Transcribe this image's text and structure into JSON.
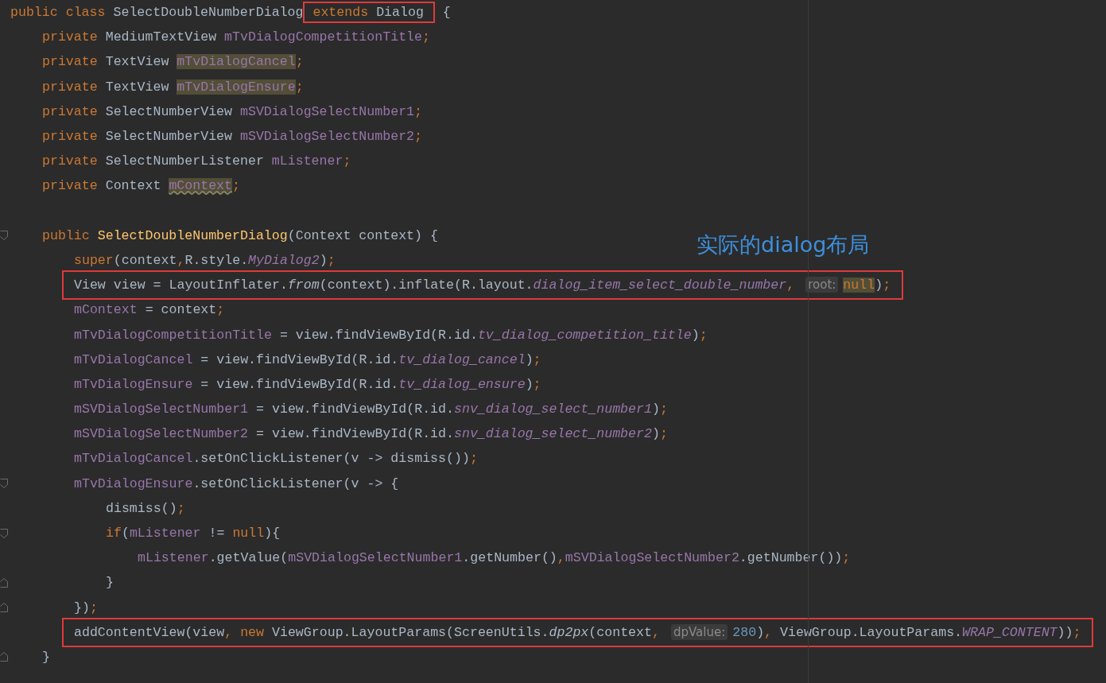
{
  "annotation": {
    "text": "实际的dialog布局"
  },
  "lines": [
    {
      "tokens": [
        {
          "t": "public class",
          "kind": "kw"
        },
        {
          "t": "SelectDoubleNumberDialog",
          "kind": "plain"
        },
        {
          "boxed": true,
          "tokens": [
            {
              "t": "extends",
              "kind": "kw"
            },
            {
              "t": "Dialog",
              "kind": "plain"
            }
          ]
        },
        {
          "t": "{",
          "kind": "plain"
        }
      ],
      "children": [
        {
          "tokens": [
            {
              "t": "private",
              "kind": "kw"
            },
            {
              "t": "MediumTextView",
              "kind": "plain"
            },
            {
              "t": "mTvDialogCompetitionTitle",
              "kind": "field"
            },
            {
              "t": ";",
              "kind": "kw"
            }
          ]
        },
        {
          "tokens": [
            {
              "t": "private",
              "kind": "kw"
            },
            {
              "t": "TextView",
              "kind": "plain"
            },
            {
              "t": "mTvDialogCancel",
              "kind": "field",
              "highlighted": true
            },
            {
              "t": ";",
              "kind": "kw"
            }
          ]
        },
        {
          "tokens": [
            {
              "t": "private",
              "kind": "kw"
            },
            {
              "t": "TextView",
              "kind": "plain"
            },
            {
              "t": "mTvDialogEnsure",
              "kind": "field",
              "highlighted": true
            },
            {
              "t": ";",
              "kind": "kw"
            }
          ]
        },
        {
          "tokens": [
            {
              "t": "private",
              "kind": "kw"
            },
            {
              "t": "SelectNumberView",
              "kind": "plain"
            },
            {
              "t": "mSVDialogSelectNumber1",
              "kind": "field"
            },
            {
              "t": ";",
              "kind": "kw"
            }
          ]
        },
        {
          "tokens": [
            {
              "t": "private",
              "kind": "kw"
            },
            {
              "t": "SelectNumberView",
              "kind": "plain"
            },
            {
              "t": "mSVDialogSelectNumber2",
              "kind": "field"
            },
            {
              "t": ";",
              "kind": "kw"
            }
          ]
        },
        {
          "tokens": [
            {
              "t": "private",
              "kind": "kw"
            },
            {
              "t": "SelectNumberListener",
              "kind": "plain"
            },
            {
              "t": "mListener",
              "kind": "field"
            },
            {
              "t": ";",
              "kind": "kw"
            }
          ]
        },
        {
          "tokens": [
            {
              "t": "private",
              "kind": "kw"
            },
            {
              "t": "Context",
              "kind": "plain"
            },
            {
              "t": "mContext",
              "kind": "field",
              "highlighted": true,
              "warning": true
            },
            {
              "t": ";",
              "kind": "kw"
            }
          ]
        },
        {
          "blank_line_before": true,
          "fold_start": true,
          "tokens": [
            {
              "t": "public",
              "kind": "kw"
            },
            {
              "t": "SelectDoubleNumberDialog",
              "kind": "decl"
            },
            {
              "t": "(Context context) {",
              "kind": "plain"
            }
          ],
          "children": [
            {
              "tokens": [
                {
                  "t": "super",
                  "kind": "kw"
                },
                {
                  "t": "(context",
                  "kind": "plain"
                },
                {
                  "t": ",",
                  "kind": "kw"
                },
                {
                  "t": "R.style.",
                  "kind": "plain"
                },
                {
                  "t": "MyDialog2",
                  "kind": "static"
                },
                {
                  "t": ")",
                  "kind": "plain"
                },
                {
                  "t": ";",
                  "kind": "kw"
                }
              ]
            },
            {
              "boxed": true,
              "tokens": [
                {
                  "t": "View view = LayoutInflater.",
                  "kind": "plain"
                },
                {
                  "t": "from",
                  "kind": "italic"
                },
                {
                  "t": "(context).inflate(R.layout.",
                  "kind": "plain"
                },
                {
                  "t": "dialog_item_select_double_number",
                  "kind": "static"
                },
                {
                  "t": ",",
                  "kind": "kw"
                },
                {
                  "t": "root:",
                  "kind": "hint"
                },
                {
                  "t": "null",
                  "kind": "kw",
                  "highlighted": true
                },
                {
                  "t": ")",
                  "kind": "plain"
                },
                {
                  "t": ";",
                  "kind": "kw"
                }
              ]
            },
            {
              "tokens": [
                {
                  "t": "mContext",
                  "kind": "field"
                },
                {
                  "t": "= context",
                  "kind": "plain"
                },
                {
                  "t": ";",
                  "kind": "kw"
                }
              ]
            },
            {
              "tokens": [
                {
                  "t": "mTvDialogCompetitionTitle",
                  "kind": "field"
                },
                {
                  "t": "= view.findViewById(R.id.",
                  "kind": "plain"
                },
                {
                  "t": "tv_dialog_competition_title",
                  "kind": "static"
                },
                {
                  "t": ")",
                  "kind": "plain"
                },
                {
                  "t": ";",
                  "kind": "kw"
                }
              ]
            },
            {
              "tokens": [
                {
                  "t": "mTvDialogCancel",
                  "kind": "field"
                },
                {
                  "t": "= view.findViewById(R.id.",
                  "kind": "plain"
                },
                {
                  "t": "tv_dialog_cancel",
                  "kind": "static"
                },
                {
                  "t": ")",
                  "kind": "plain"
                },
                {
                  "t": ";",
                  "kind": "kw"
                }
              ]
            },
            {
              "tokens": [
                {
                  "t": "mTvDialogEnsure",
                  "kind": "field"
                },
                {
                  "t": "= view.findViewById(R.id.",
                  "kind": "plain"
                },
                {
                  "t": "tv_dialog_ensure",
                  "kind": "static"
                },
                {
                  "t": ")",
                  "kind": "plain"
                },
                {
                  "t": ";",
                  "kind": "kw"
                }
              ]
            },
            {
              "tokens": [
                {
                  "t": "mSVDialogSelectNumber1",
                  "kind": "field"
                },
                {
                  "t": "= view.findViewById(R.id.",
                  "kind": "plain"
                },
                {
                  "t": "snv_dialog_select_number1",
                  "kind": "static"
                },
                {
                  "t": ")",
                  "kind": "plain"
                },
                {
                  "t": ";",
                  "kind": "kw"
                }
              ]
            },
            {
              "tokens": [
                {
                  "t": "mSVDialogSelectNumber2",
                  "kind": "field"
                },
                {
                  "t": "= view.findViewById(R.id.",
                  "kind": "plain"
                },
                {
                  "t": "snv_dialog_select_number2",
                  "kind": "static"
                },
                {
                  "t": ")",
                  "kind": "plain"
                },
                {
                  "t": ";",
                  "kind": "kw"
                }
              ]
            },
            {
              "tokens": [
                {
                  "t": "mTvDialogCancel",
                  "kind": "field"
                },
                {
                  "t": ".setOnClickListener(v -> dismiss())",
                  "kind": "plain"
                },
                {
                  "t": ";",
                  "kind": "kw"
                }
              ]
            },
            {
              "fold_start": true,
              "tokens": [
                {
                  "t": "mTvDialogEnsure",
                  "kind": "field"
                },
                {
                  "t": ".setOnClickListener(v -> {",
                  "kind": "plain"
                }
              ],
              "children": [
                {
                  "tokens": [
                    {
                      "t": "dismiss()",
                      "kind": "plain"
                    },
                    {
                      "t": ";",
                      "kind": "kw"
                    }
                  ]
                },
                {
                  "fold_start": true,
                  "tokens": [
                    {
                      "t": "if",
                      "kind": "kw"
                    },
                    {
                      "t": "(",
                      "kind": "plain"
                    },
                    {
                      "t": "mListener",
                      "kind": "field"
                    },
                    {
                      "t": "!=",
                      "kind": "plain"
                    },
                    {
                      "t": "null",
                      "kind": "kw"
                    },
                    {
                      "t": "){",
                      "kind": "plain"
                    }
                  ],
                  "children": [
                    {
                      "tokens": [
                        {
                          "t": "mListener",
                          "kind": "field"
                        },
                        {
                          "t": ".getValue(",
                          "kind": "plain"
                        },
                        {
                          "t": "mSVDialogSelectNumber1",
                          "kind": "field"
                        },
                        {
                          "t": ".getNumber()",
                          "kind": "plain"
                        },
                        {
                          "t": ",",
                          "kind": "kw"
                        },
                        {
                          "t": "mSVDialogSelectNumber2",
                          "kind": "field"
                        },
                        {
                          "t": ".getNumber())",
                          "kind": "plain"
                        },
                        {
                          "t": ";",
                          "kind": "kw"
                        }
                      ]
                    }
                  ]
                },
                {
                  "fold_end": true,
                  "tokens": [
                    {
                      "t": "}",
                      "kind": "plain"
                    }
                  ]
                }
              ]
            },
            {
              "fold_end": true,
              "tokens": [
                {
                  "t": "})",
                  "kind": "plain"
                },
                {
                  "t": ";",
                  "kind": "kw"
                }
              ]
            },
            {
              "boxed": true,
              "tokens": [
                {
                  "t": "addContentView(view",
                  "kind": "plain"
                },
                {
                  "t": ",",
                  "kind": "kw"
                },
                {
                  "t": "new",
                  "kind": "kw"
                },
                {
                  "t": "ViewGroup.LayoutParams(ScreenUtils.",
                  "kind": "plain"
                },
                {
                  "t": "dp2px",
                  "kind": "italic"
                },
                {
                  "t": "(context",
                  "kind": "plain"
                },
                {
                  "t": ",",
                  "kind": "kw"
                },
                {
                  "t": "dpValue:",
                  "kind": "hint"
                },
                {
                  "t": "280",
                  "kind": "num"
                },
                {
                  "t": ")",
                  "kind": "plain"
                },
                {
                  "t": ",",
                  "kind": "kw"
                },
                {
                  "t": "ViewGroup.LayoutParams.",
                  "kind": "plain"
                },
                {
                  "t": "WRAP_CONTENT",
                  "kind": "static"
                },
                {
                  "t": "))",
                  "kind": "plain"
                },
                {
                  "t": ";",
                  "kind": "kw"
                }
              ]
            }
          ]
        },
        {
          "fold_end": true,
          "tokens": [
            {
              "t": "}",
              "kind": "plain"
            }
          ]
        }
      ]
    }
  ]
}
